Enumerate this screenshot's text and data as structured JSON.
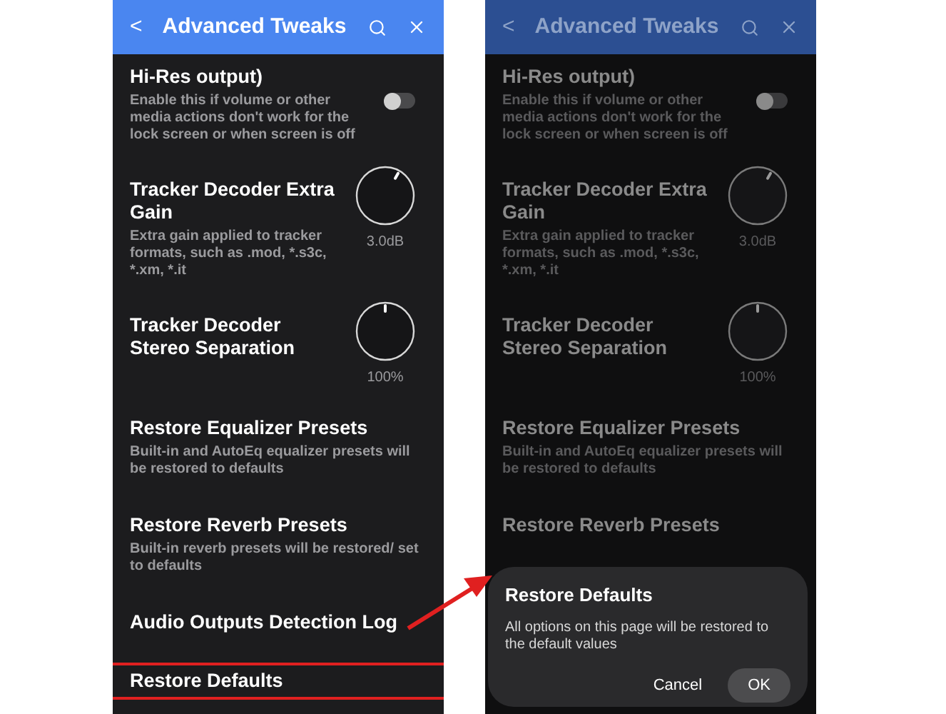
{
  "screens": [
    {
      "dimmed": false,
      "header": {
        "back": "<",
        "title": "Advanced Tweaks"
      },
      "items": [
        {
          "kind": "toggle",
          "title": "Hi-Res output)",
          "description": "Enable this if volume or other media actions don't work for the lock screen or when screen is off",
          "on": false
        },
        {
          "kind": "knob",
          "title": "Tracker Decoder Extra Gain",
          "description": "Extra gain applied to tracker formats, such as .mod, *.s3c, *.xm, *.it",
          "reading": "3.0dB"
        },
        {
          "kind": "knob",
          "title": "Tracker Decoder Stereo Separation",
          "reading": "100%"
        },
        {
          "kind": "action",
          "title": "Restore Equalizer Presets",
          "description": "Built-in and AutoEq equalizer presets will be restored to defaults",
          "highlighted": false
        },
        {
          "kind": "action",
          "title": "Restore Reverb Presets",
          "description": "Built-in reverb presets will be restored/ set to defaults",
          "highlighted": false
        },
        {
          "kind": "action",
          "title": "Audio Outputs Detection Log",
          "highlighted": false
        },
        {
          "kind": "action",
          "title": "Restore Defaults",
          "highlighted": true
        }
      ]
    },
    {
      "dimmed": true,
      "header": {
        "back": "<",
        "title": "Advanced Tweaks"
      },
      "items": [
        {
          "kind": "toggle",
          "title": "Hi-Res output)",
          "description": "Enable this if volume or other media actions don't work for the lock screen or when screen is off",
          "on": false
        },
        {
          "kind": "knob",
          "title": "Tracker Decoder Extra Gain",
          "description": "Extra gain applied to tracker formats, such as .mod, *.s3c, *.xm, *.it",
          "reading": "3.0dB"
        },
        {
          "kind": "knob",
          "title": "Tracker Decoder Stereo Separation",
          "reading": "100%"
        },
        {
          "kind": "action",
          "title": "Restore Equalizer Presets",
          "description": "Built-in and AutoEq equalizer presets will be restored to defaults",
          "highlighted": false
        },
        {
          "kind": "action",
          "title": "Restore Reverb Presets",
          "highlighted": false
        }
      ],
      "dialog": {
        "title": "Restore Defaults",
        "message": "All options on this page will be restored to the default values",
        "buttons": [
          "Cancel",
          "OK"
        ]
      }
    }
  ],
  "callout_arrow": true
}
